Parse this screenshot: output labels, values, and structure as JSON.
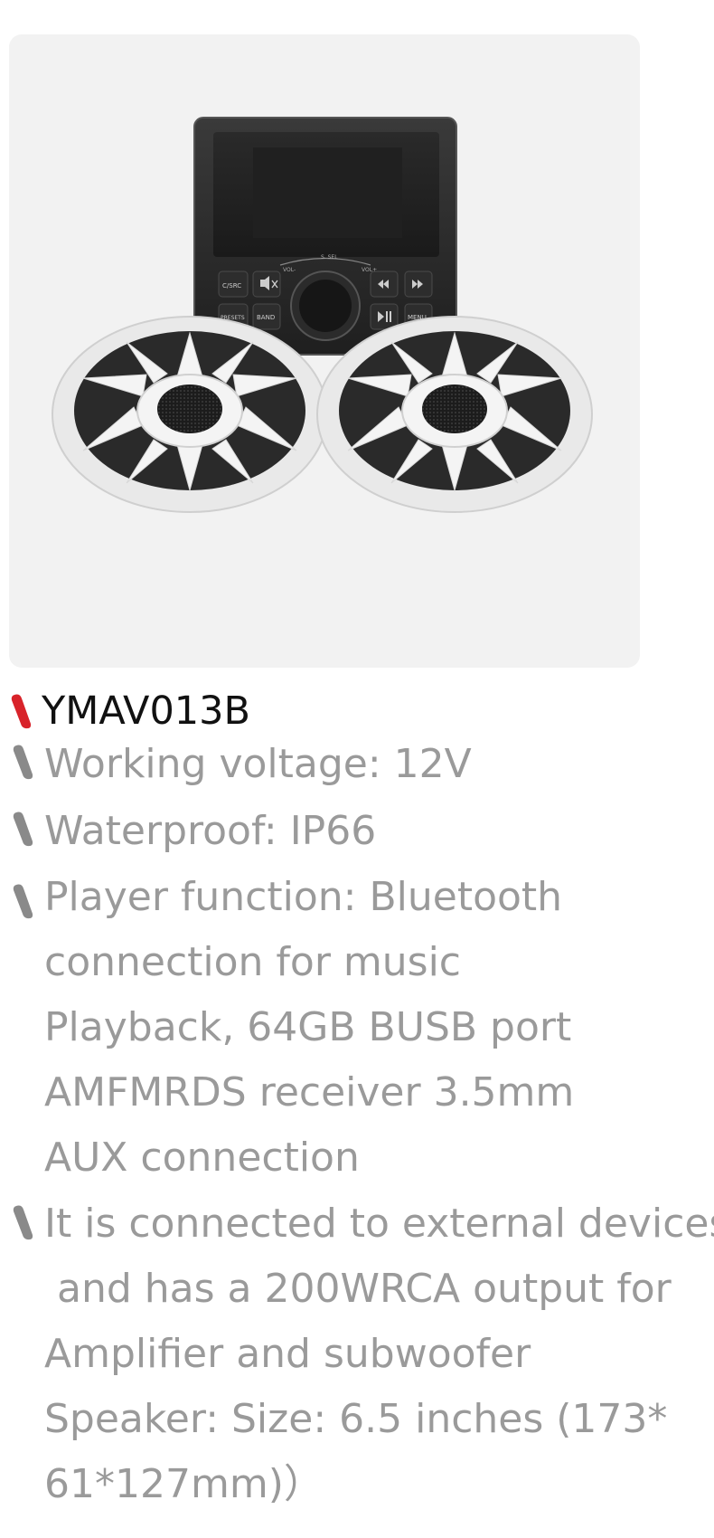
{
  "product": {
    "model": "YMAV013B",
    "image_alt": "Marine audio head unit with two white speakers",
    "unit_display": {
      "buttons": [
        "C/SRC",
        "",
        "",
        "",
        "PRESETS",
        "BAND",
        "",
        "MENU"
      ],
      "knob_labels": [
        "VOL-",
        "S. SEL",
        "VOL+"
      ]
    }
  },
  "specs": [
    {
      "lines": [
        "Working voltage: 12V"
      ]
    },
    {
      "lines": [
        "Waterproof: IP66"
      ]
    },
    {
      "lines": [
        "Player function: Bluetooth",
        "connection for music",
        "Playback, 64GB BUSB port",
        "AMFMRDS receiver 3.5mm",
        "AUX connection"
      ]
    },
    {
      "lines": [
        "It is connected to external devices",
        " and has a 200WRCA output for",
        "Amplifier and subwoofer",
        "Speaker: Size: 6.5 inches (173*",
        "61*127mm)）"
      ]
    }
  ],
  "colors": {
    "accent_bullet": "#d8232a",
    "bullet": "#8a8a8a",
    "spec_text": "#9a9a9a",
    "title_text": "#111111",
    "card_bg": "#f2f2f2"
  }
}
